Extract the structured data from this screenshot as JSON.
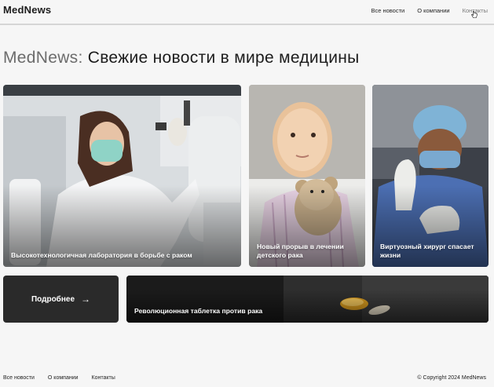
{
  "header": {
    "logo": "MedNews",
    "nav": [
      "Все новости",
      "О компании",
      "Контакты"
    ]
  },
  "headline": {
    "brand": "MedNews:",
    "text": " Свежие новости в мире медицины"
  },
  "cards": [
    {
      "caption": "Высокотехнологичная лаборатория в борьбе с раком"
    },
    {
      "caption": "Новый прорыв в лечении детского рака"
    },
    {
      "caption": "Виртуозный хирург спасает жизни"
    },
    {
      "caption": "Революционная таблетка против рака"
    }
  ],
  "more_button": {
    "label": "Подробнее",
    "arrow": "→"
  },
  "footer": {
    "nav": [
      "Все новости",
      "О компании",
      "Контакты"
    ],
    "copyright": "© Copyright 2024 MedNews"
  },
  "colors": {
    "background": "#f6f6f6",
    "text": "#1f1f1f",
    "brand_gray": "#6c6c6c",
    "button_dark": "#2a2a2a"
  },
  "icons": [
    "cursor-hand-icon",
    "arrow-right-icon"
  ]
}
